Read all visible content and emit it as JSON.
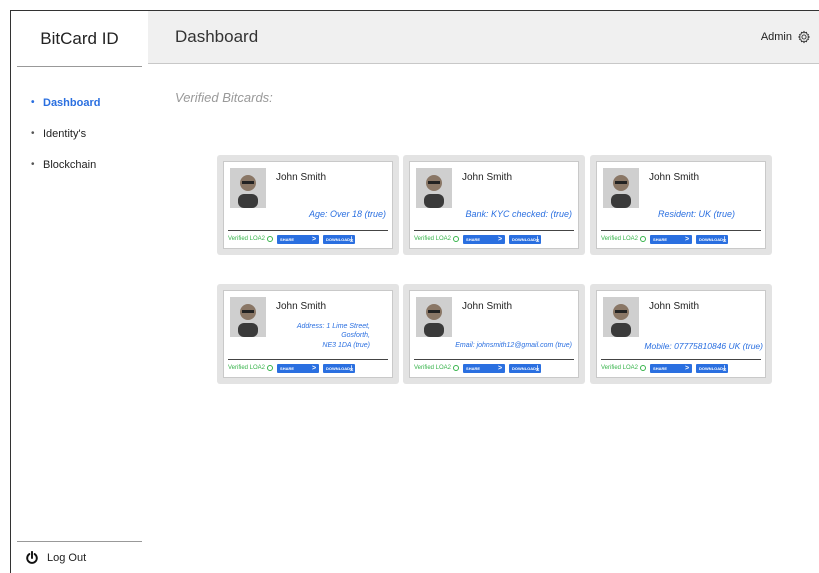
{
  "brand": "BitCard ID",
  "header": {
    "title": "Dashboard",
    "user": "Admin"
  },
  "nav": [
    {
      "label": "Dashboard",
      "active": true
    },
    {
      "label": "Identity's",
      "active": false
    },
    {
      "label": "Blockchain",
      "active": false
    }
  ],
  "logout": "Log Out",
  "section_title": "Verified Bitcards:",
  "cards": [
    {
      "name": "John Smith",
      "claim": "Age: Over 18 (true)",
      "verified": "Verified LOA2",
      "share": "SHARE",
      "download": "DOWNLOAD"
    },
    {
      "name": "John Smith",
      "claim": "Bank: KYC checked: (true)",
      "verified": "Verified LOA2",
      "share": "SHARE",
      "download": "DOWNLOAD"
    },
    {
      "name": "John Smith",
      "claim": "Resident: UK (true)",
      "verified": "Verified LOA2",
      "share": "SHARE",
      "download": "DOWNLOAD"
    },
    {
      "name": "John Smith",
      "claim_lines": [
        "Address: 1 Lime Street,",
        "Gosforth,",
        "NE3 1DA (true)"
      ],
      "verified": "Verified LOA2",
      "share": "SHARE",
      "download": "DOWNLOAD"
    },
    {
      "name": "John Smith",
      "claim": "Email: johnsmith12@gmail.com (true)",
      "verified": "Verified LOA2",
      "share": "SHARE",
      "download": "DOWNLOAD"
    },
    {
      "name": "John Smith",
      "claim": "Mobile: 07775810846 UK (true)",
      "verified": "Verified LOA2",
      "share": "SHARE",
      "download": "DOWNLOAD"
    }
  ],
  "colors": {
    "accent": "#2a6fe0",
    "verified": "#36b34a",
    "topbar": "#f0f0f0",
    "card_bg": "#e3e3e3"
  }
}
